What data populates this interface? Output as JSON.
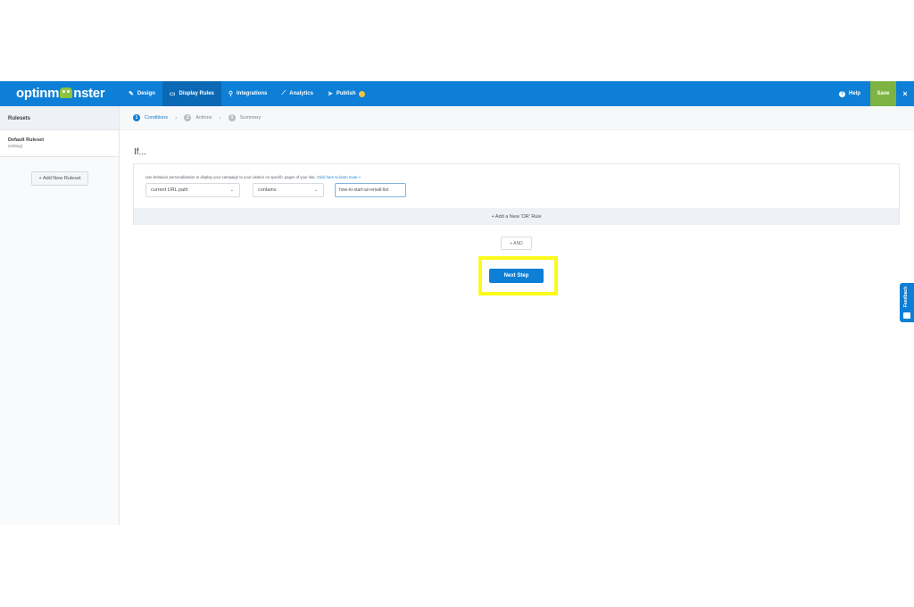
{
  "app": {
    "logo": "optinmonster"
  },
  "topbar": {
    "nav": [
      {
        "label": "Design",
        "icon": "pencil-icon"
      },
      {
        "label": "Display Rules",
        "icon": "monitor-icon"
      },
      {
        "label": "Integrations",
        "icon": "plug-icon"
      },
      {
        "label": "Analytics",
        "icon": "chart-icon"
      },
      {
        "label": "Publish",
        "icon": "paper-plane-icon"
      }
    ],
    "help_label": "Help",
    "save_label": "Save",
    "close_label": "×"
  },
  "sidebar": {
    "title": "Rulesets",
    "ruleset": {
      "name": "Default Ruleset",
      "status": "(editing)"
    },
    "add_label": "+ Add New Ruleset"
  },
  "steps": [
    {
      "num": "1",
      "label": "Conditions"
    },
    {
      "num": "2",
      "label": "Actions"
    },
    {
      "num": "3",
      "label": "Summary"
    }
  ],
  "main": {
    "if_label": "If...",
    "description": "Use behavior personalization to display your campaign to your visitors on specific pages of your site.",
    "learn_more": "Click here to learn more »",
    "condition": {
      "field": "current URL path",
      "operator": "contains",
      "value": "how-to-start-an-email-list"
    },
    "or_rule_label": "+ Add a New 'OR' Rule",
    "and_label": "+ AND",
    "next_step_label": "Next Step"
  },
  "feedback": {
    "label": "Feedback"
  }
}
